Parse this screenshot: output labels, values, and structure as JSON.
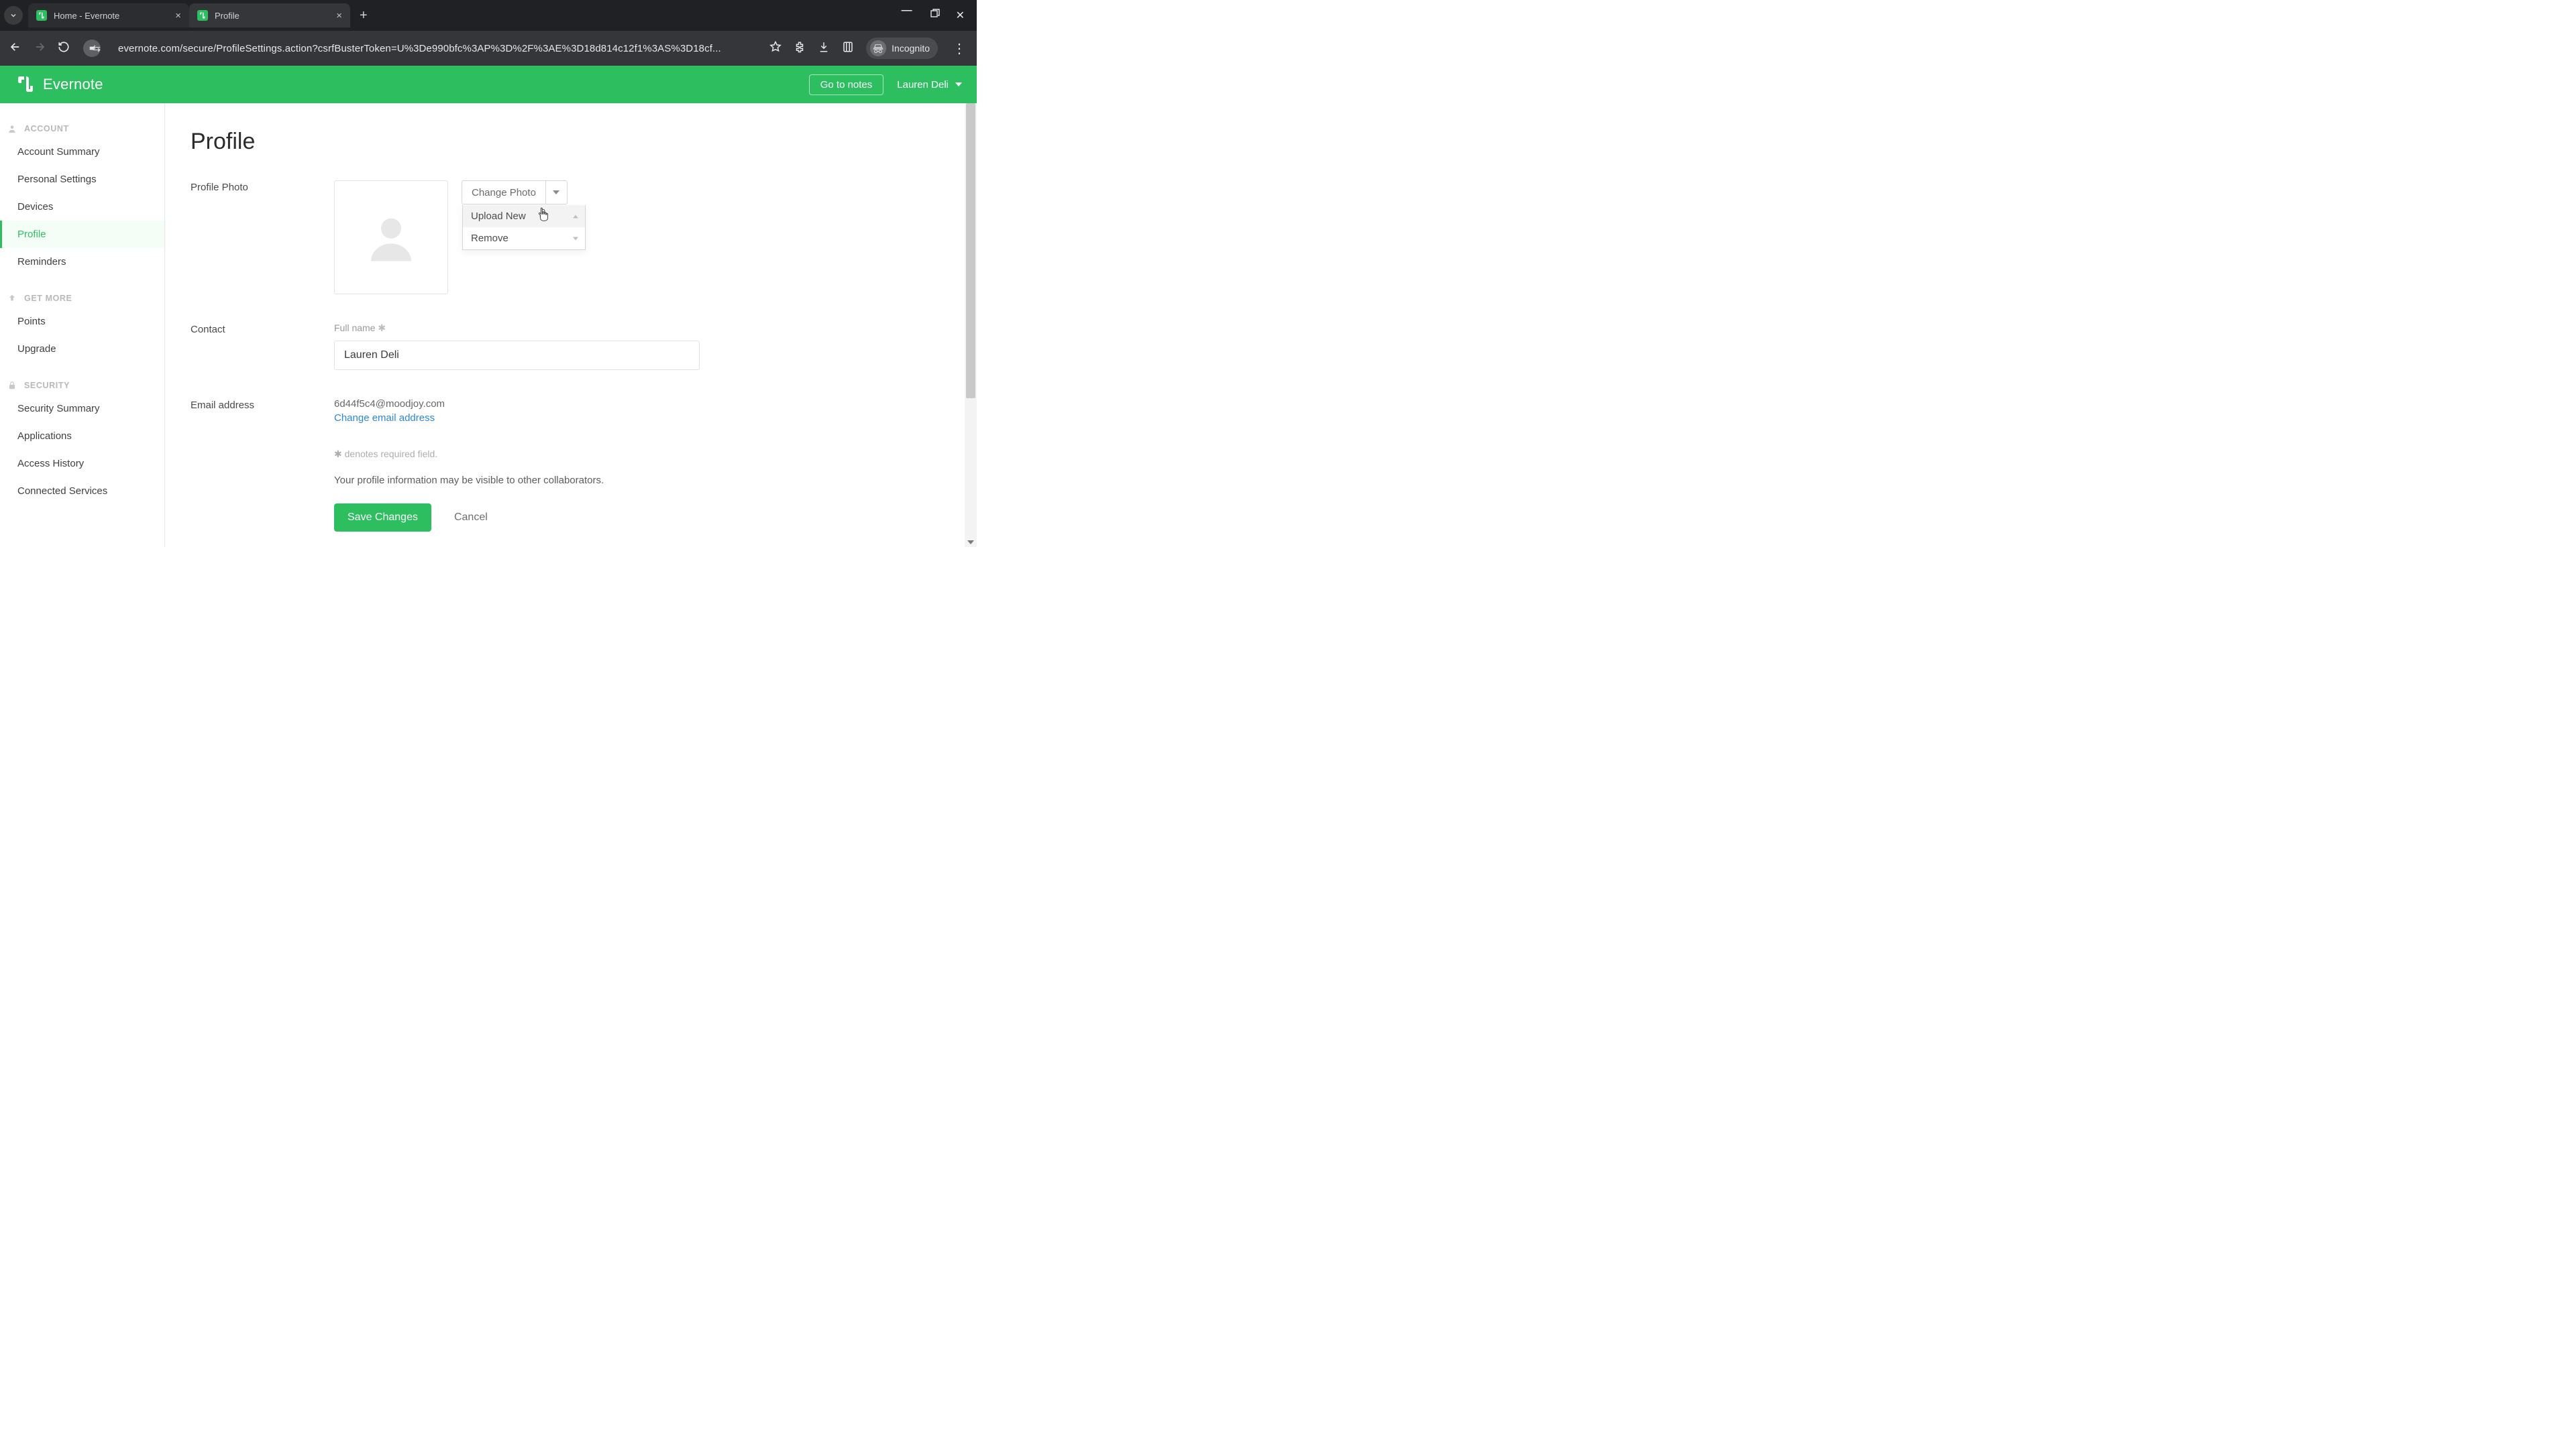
{
  "browser": {
    "tabs": [
      {
        "title": "Home - Evernote",
        "active": false
      },
      {
        "title": "Profile",
        "active": true
      }
    ],
    "url": "evernote.com/secure/ProfileSettings.action?csrfBusterToken=U%3De990bfc%3AP%3D%2F%3AE%3D18d814c12f1%3AS%3D18cf...",
    "incognito_label": "Incognito"
  },
  "header": {
    "brand": "Evernote",
    "goto_notes": "Go to notes",
    "user_name": "Lauren Deli"
  },
  "sidebar": {
    "sections": [
      {
        "heading": "ACCOUNT",
        "icon": "user",
        "items": [
          {
            "label": "Account Summary",
            "key": "account-summary"
          },
          {
            "label": "Personal Settings",
            "key": "personal-settings"
          },
          {
            "label": "Devices",
            "key": "devices"
          },
          {
            "label": "Profile",
            "key": "profile",
            "active": true
          },
          {
            "label": "Reminders",
            "key": "reminders"
          }
        ]
      },
      {
        "heading": "GET MORE",
        "icon": "arrow-up",
        "items": [
          {
            "label": "Points",
            "key": "points"
          },
          {
            "label": "Upgrade",
            "key": "upgrade"
          }
        ]
      },
      {
        "heading": "SECURITY",
        "icon": "lock",
        "items": [
          {
            "label": "Security Summary",
            "key": "security-summary"
          },
          {
            "label": "Applications",
            "key": "applications"
          },
          {
            "label": "Access History",
            "key": "access-history"
          },
          {
            "label": "Connected Services",
            "key": "connected-services"
          }
        ]
      }
    ]
  },
  "page": {
    "title": "Profile",
    "photo": {
      "label": "Profile Photo",
      "change_label": "Change Photo",
      "menu": {
        "upload": "Upload New",
        "remove": "Remove"
      }
    },
    "contact": {
      "label": "Contact",
      "full_name_label": "Full name",
      "full_name_value": "Lauren Deli"
    },
    "email": {
      "label": "Email address",
      "value": "6d44f5c4@moodjoy.com",
      "change_link": "Change email address"
    },
    "required_note": "✱ denotes required field.",
    "visibility_note": "Your profile information may be visible to other collaborators.",
    "save_label": "Save Changes",
    "cancel_label": "Cancel"
  }
}
